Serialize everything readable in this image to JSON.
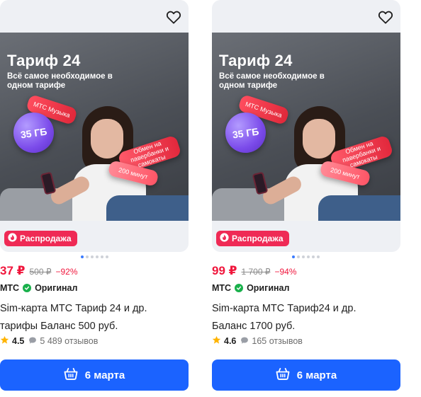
{
  "colors": {
    "accent": "#1b63ff",
    "sale": "#ef2a55",
    "price": "#f0163c",
    "original": "#19b04b",
    "star": "#ffb400"
  },
  "products": [
    {
      "banner": {
        "title": "Тариф 24",
        "subtitle": "Всё самое необходимое в одном тарифе",
        "tag_music": "МТС Музыка",
        "tag_gb": "35 ГБ",
        "tag_swap": "Обмен на павербанки и самокаты",
        "tag_minutes": "200 минут"
      },
      "sale_badge": "Распродажа",
      "price": "37 ₽",
      "old_price": "500 ₽",
      "discount": "−92%",
      "brand": "МТС",
      "original_label": "Оригинал",
      "title_line1": "Sim-карта МТС Тариф 24 и др.",
      "title_line2": "тарифы Баланс 500 руб.",
      "rating": "4.5",
      "reviews": "5 489 отзывов",
      "delivery": "6 марта",
      "image_dots": 6,
      "active_dot": 0
    },
    {
      "banner": {
        "title": "Тариф 24",
        "subtitle": "Всё самое необходимое в одном тарифе",
        "tag_music": "МТС Музыка",
        "tag_gb": "35 ГБ",
        "tag_swap": "Обмен на павербанки и самокаты",
        "tag_minutes": "200 минут"
      },
      "sale_badge": "Распродажа",
      "price": "99 ₽",
      "old_price": "1 700 ₽",
      "discount": "−94%",
      "brand": "МТС",
      "original_label": "Оригинал",
      "title_line1": "Sim-карта МТС Тариф24 и др.",
      "title_line2": "Баланс 1700 руб.",
      "rating": "4.6",
      "reviews": "165 отзывов",
      "delivery": "6 марта",
      "image_dots": 6,
      "active_dot": 0
    }
  ]
}
